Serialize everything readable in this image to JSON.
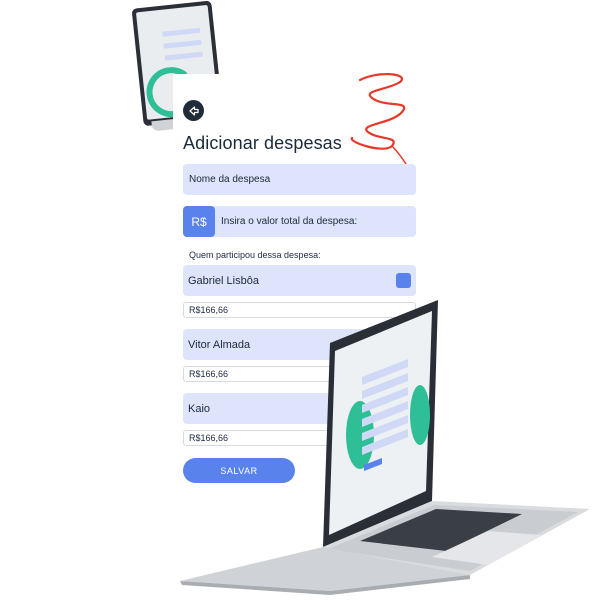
{
  "form": {
    "title": "Adicionar despesas",
    "name_field": "Nome da despesa",
    "currency_symbol": "R$",
    "value_placeholder": "Insira o valor total da despesa:",
    "participants_label": "Quem participou dessa despesa:",
    "participants": [
      {
        "name": "Gabriel Lisbôa",
        "amount": "R$166,66",
        "checked": true
      },
      {
        "name": "Vitor Almada",
        "amount": "R$166,66",
        "checked": false
      },
      {
        "name": "Kaio",
        "amount": "R$166,66",
        "checked": false
      }
    ],
    "save_label": "SALVAR"
  },
  "colors": {
    "accent": "#5a82ec",
    "field_bg": "#dde4fb",
    "title_text": "#1a2a3a",
    "decor_green": "#2fbf97",
    "decor_red": "#e8382a"
  },
  "icons": {
    "back": "back-arrow-icon",
    "check": "checkbox-checked-icon"
  }
}
